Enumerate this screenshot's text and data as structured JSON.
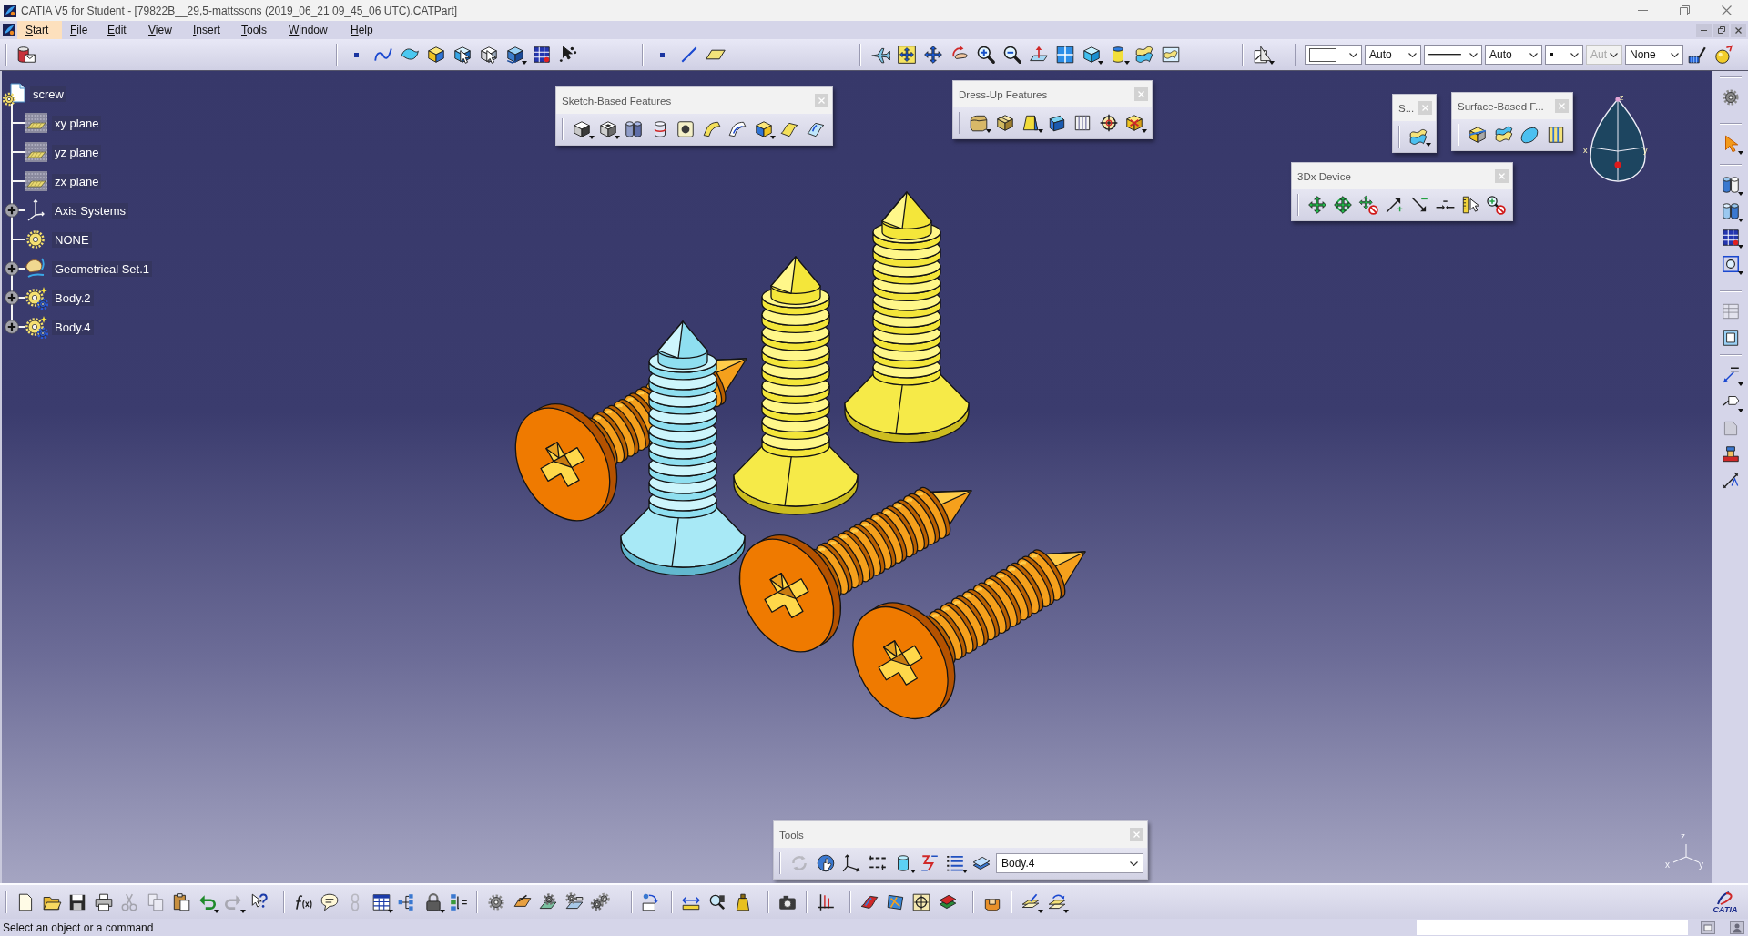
{
  "window": {
    "title": "CATIA V5 for Student - [79822B__29,5-mattssons (2019_06_21 09_45_06 UTC).CATPart]"
  },
  "menu_bar": {
    "items": [
      {
        "label": "Start",
        "selected": true
      },
      {
        "label": "File",
        "selected": false
      },
      {
        "label": "Edit",
        "selected": false
      },
      {
        "label": "View",
        "selected": false
      },
      {
        "label": "Insert",
        "selected": false
      },
      {
        "label": "Tools",
        "selected": false
      },
      {
        "label": "Window",
        "selected": false
      },
      {
        "label": "Help",
        "selected": false
      }
    ]
  },
  "top_toolbar": {
    "groups": [
      {
        "buttons": [
          {
            "kind": "part",
            "flyout": false,
            "disabled": false
          }
        ]
      },
      {
        "buttons": [
          {
            "kind": "point",
            "flyout": false,
            "disabled": false
          },
          {
            "kind": "spline",
            "flyout": false,
            "disabled": false
          },
          {
            "kind": "surface",
            "flyout": false,
            "disabled": false
          },
          {
            "kind": "boxface",
            "flyout": false,
            "disabled": false
          },
          {
            "kind": "extrude",
            "flyout": false,
            "disabled": false
          },
          {
            "kind": "revolve",
            "flyout": false,
            "disabled": false
          },
          {
            "kind": "blocks",
            "flyout": true,
            "disabled": false
          },
          {
            "kind": "grid",
            "flyout": false,
            "disabled": false
          },
          {
            "kind": "cursor",
            "flyout": false,
            "disabled": false
          }
        ]
      },
      {
        "buttons": [
          {
            "kind": "point",
            "flyout": false,
            "disabled": false
          },
          {
            "kind": "line",
            "flyout": false,
            "disabled": false
          },
          {
            "kind": "plane",
            "flyout": false,
            "disabled": false
          }
        ]
      },
      {
        "buttons": [
          {
            "kind": "fly",
            "flyout": false,
            "disabled": false
          },
          {
            "kind": "fitall",
            "flyout": false,
            "disabled": false
          },
          {
            "kind": "pan",
            "flyout": false,
            "disabled": false
          },
          {
            "kind": "rotate",
            "flyout": false,
            "disabled": false
          },
          {
            "kind": "zoomin",
            "flyout": false,
            "disabled": false
          },
          {
            "kind": "zoomout",
            "flyout": false,
            "disabled": false
          },
          {
            "kind": "normal",
            "flyout": false,
            "disabled": false
          },
          {
            "kind": "views",
            "flyout": false,
            "disabled": false
          },
          {
            "kind": "iso",
            "flyout": true,
            "disabled": false
          },
          {
            "kind": "shading",
            "flyout": true,
            "disabled": false
          },
          {
            "kind": "hide",
            "flyout": false,
            "disabled": false
          },
          {
            "kind": "swap",
            "flyout": false,
            "disabled": false
          }
        ]
      },
      {
        "buttons": [
          {
            "kind": "drafting",
            "flyout": true,
            "disabled": false
          }
        ]
      },
      {
        "combos": [
          {
            "kind": "swatch",
            "disabled": false
          },
          {
            "kind": "text",
            "value": "Auto",
            "disabled": false
          },
          {
            "kind": "line",
            "disabled": false
          },
          {
            "kind": "text",
            "value": "Auto",
            "disabled": false
          },
          {
            "kind": "point",
            "disabled": false
          },
          {
            "kind": "text",
            "value": "Aut",
            "disabled": true
          },
          {
            "kind": "text",
            "value": "None",
            "disabled": false
          }
        ],
        "buttons": [
          {
            "kind": "brush",
            "flyout": false,
            "disabled": false
          },
          {
            "kind": "paint",
            "flyout": false,
            "disabled": false
          }
        ]
      }
    ]
  },
  "tree": {
    "label": "screw",
    "kind": "part",
    "children": [
      {
        "label": "xy plane",
        "kind": "plane",
        "collapsed": false
      },
      {
        "label": "yz plane",
        "kind": "plane",
        "collapsed": false
      },
      {
        "label": "zx plane",
        "kind": "plane",
        "collapsed": false
      },
      {
        "label": "Axis Systems",
        "kind": "axes",
        "collapsed": true
      },
      {
        "label": "NONE",
        "kind": "body",
        "collapsed": false
      },
      {
        "label": "Geometrical Set.1",
        "kind": "geoset",
        "collapsed": true
      },
      {
        "label": "Body.2",
        "kind": "body_star",
        "collapsed": true
      },
      {
        "label": "Body.4",
        "kind": "body_star",
        "collapsed": true
      }
    ]
  },
  "floating_toolbars": [
    {
      "title": "Sketch-Based Features",
      "buttons": [
        {
          "kind": "pad",
          "flyout": true,
          "disabled": false
        },
        {
          "kind": "pocket",
          "flyout": true,
          "disabled": false
        },
        {
          "kind": "shaft",
          "flyout": false,
          "disabled": false
        },
        {
          "kind": "groove",
          "flyout": false,
          "disabled": false
        },
        {
          "kind": "hole",
          "flyout": false,
          "disabled": false
        },
        {
          "kind": "rib",
          "flyout": false,
          "disabled": false
        },
        {
          "kind": "slot",
          "flyout": false,
          "disabled": false
        },
        {
          "kind": "stiffener",
          "flyout": true,
          "disabled": false
        },
        {
          "kind": "loft",
          "flyout": false,
          "disabled": false
        },
        {
          "kind": "removeloft",
          "flyout": false,
          "disabled": false
        }
      ]
    },
    {
      "title": "Dress-Up Features",
      "buttons": [
        {
          "kind": "fillet",
          "flyout": true,
          "disabled": false
        },
        {
          "kind": "chamfer",
          "flyout": false,
          "disabled": false
        },
        {
          "kind": "draft",
          "flyout": true,
          "disabled": false
        },
        {
          "kind": "shell",
          "flyout": false,
          "disabled": false
        },
        {
          "kind": "thickness",
          "flyout": false,
          "disabled": false
        },
        {
          "kind": "thread",
          "flyout": false,
          "disabled": false
        },
        {
          "kind": "removeface",
          "flyout": true,
          "disabled": false
        }
      ]
    },
    {
      "title": "S...",
      "buttons": [
        {
          "kind": "sheet",
          "flyout": true,
          "disabled": false
        }
      ]
    },
    {
      "title": "Surface-Based F...",
      "buttons": [
        {
          "kind": "split",
          "flyout": false,
          "disabled": false
        },
        {
          "kind": "thicksurface",
          "flyout": false,
          "disabled": false
        },
        {
          "kind": "closesurface",
          "flyout": false,
          "disabled": false
        },
        {
          "kind": "sew",
          "flyout": false,
          "disabled": false
        }
      ]
    },
    {
      "title": "3Dx Device",
      "buttons": [
        {
          "kind": "pan3d",
          "flyout": false,
          "disabled": false
        },
        {
          "kind": "orbit3d",
          "flyout": false,
          "disabled": false
        },
        {
          "kind": "panoff",
          "flyout": false,
          "disabled": false
        },
        {
          "kind": "zoomin3d",
          "flyout": false,
          "disabled": false
        },
        {
          "kind": "zoomout3d",
          "flyout": false,
          "disabled": false
        },
        {
          "kind": "dominant",
          "flyout": false,
          "disabled": false
        },
        {
          "kind": "sensitivity",
          "flyout": false,
          "disabled": false
        },
        {
          "kind": "zoomoff",
          "flyout": false,
          "disabled": false
        }
      ]
    },
    {
      "title": "Tools",
      "buttons": [
        {
          "kind": "update",
          "flyout": false,
          "disabled": true
        },
        {
          "kind": "globe",
          "flyout": false,
          "disabled": false
        },
        {
          "kind": "axis",
          "flyout": false,
          "disabled": false
        },
        {
          "kind": "values",
          "flyout": false,
          "disabled": false
        },
        {
          "kind": "cylinder",
          "flyout": true,
          "disabled": false
        },
        {
          "kind": "zigzag",
          "flyout": false,
          "disabled": false
        },
        {
          "kind": "list",
          "flyout": true,
          "disabled": false
        },
        {
          "kind": "body",
          "flyout": false,
          "disabled": false
        }
      ],
      "combo": {
        "value": "Body.4"
      }
    }
  ],
  "compass": {
    "axis_labels": [
      "z",
      "x",
      "y"
    ]
  },
  "axis_triad": {
    "axis_labels": [
      "z",
      "x",
      "y"
    ]
  },
  "right_toolbar": {
    "groups": [
      {
        "buttons": [
          {
            "kind": "gear",
            "flyout": false,
            "disabled": false
          }
        ]
      },
      {
        "buttons": [
          {
            "kind": "select",
            "flyout": true,
            "disabled": false
          }
        ]
      },
      {
        "buttons": [
          {
            "kind": "cubes",
            "flyout": true,
            "disabled": false
          },
          {
            "kind": "cubes2",
            "flyout": true,
            "disabled": false
          },
          {
            "kind": "grid",
            "flyout": true,
            "disabled": false
          },
          {
            "kind": "fit",
            "flyout": true,
            "disabled": false
          }
        ]
      },
      {
        "buttons": [
          {
            "kind": "table2",
            "flyout": false,
            "disabled": true
          },
          {
            "kind": "frame",
            "flyout": false,
            "disabled": false
          }
        ]
      },
      {
        "buttons": [
          {
            "kind": "abc",
            "flyout": true,
            "disabled": false
          },
          {
            "kind": "arrowshape",
            "flyout": true,
            "disabled": false
          },
          {
            "kind": "grey3",
            "flyout": false,
            "disabled": true
          },
          {
            "kind": "stamp",
            "flyout": false,
            "disabled": false
          },
          {
            "kind": "dimension",
            "flyout": false,
            "disabled": false
          }
        ]
      }
    ]
  },
  "bottom_toolbar": {
    "groups": [
      {
        "buttons": [
          {
            "kind": "new",
            "flyout": false,
            "disabled": false
          },
          {
            "kind": "open",
            "flyout": false,
            "disabled": false
          },
          {
            "kind": "save",
            "flyout": false,
            "disabled": false
          },
          {
            "kind": "print",
            "flyout": false,
            "disabled": false
          },
          {
            "kind": "cut",
            "flyout": false,
            "disabled": true
          },
          {
            "kind": "copy",
            "flyout": false,
            "disabled": true
          },
          {
            "kind": "paste",
            "flyout": false,
            "disabled": false
          },
          {
            "kind": "undo",
            "flyout": true,
            "disabled": false
          },
          {
            "kind": "redo",
            "flyout": true,
            "disabled": true
          },
          {
            "kind": "whatsthis",
            "flyout": false,
            "disabled": false
          }
        ]
      },
      {
        "buttons": [
          {
            "kind": "formula",
            "flyout": false,
            "disabled": false
          },
          {
            "kind": "bubble",
            "flyout": false,
            "disabled": false
          },
          {
            "kind": "chain",
            "flyout": false,
            "disabled": true
          },
          {
            "kind": "table",
            "flyout": true,
            "disabled": false
          },
          {
            "kind": "treegraph",
            "flyout": false,
            "disabled": false
          },
          {
            "kind": "lock",
            "flyout": true,
            "disabled": false
          },
          {
            "kind": "equations",
            "flyout": false,
            "disabled": false
          }
        ]
      },
      {
        "buttons": [
          {
            "kind": "gear",
            "flyout": false,
            "disabled": false
          },
          {
            "kind": "sketcher",
            "flyout": false,
            "disabled": false
          },
          {
            "kind": "gearsheet",
            "flyout": false,
            "disabled": false
          },
          {
            "kind": "gearpipe",
            "flyout": false,
            "disabled": false
          },
          {
            "kind": "gears",
            "flyout": false,
            "disabled": false
          }
        ]
      },
      {
        "buttons": [
          {
            "kind": "boxarrow",
            "flyout": false,
            "disabled": false
          }
        ]
      },
      {
        "buttons": [
          {
            "kind": "measure",
            "flyout": false,
            "disabled": false
          },
          {
            "kind": "inertia",
            "flyout": false,
            "disabled": false
          },
          {
            "kind": "weight",
            "flyout": false,
            "disabled": false
          }
        ]
      },
      {
        "buttons": [
          {
            "kind": "camera",
            "flyout": false,
            "disabled": false
          }
        ]
      },
      {
        "buttons": [
          {
            "kind": "axes",
            "flyout": false,
            "disabled": false
          }
        ]
      },
      {
        "buttons": [
          {
            "kind": "ribbon",
            "flyout": false,
            "disabled": false
          },
          {
            "kind": "fabric",
            "flyout": false,
            "disabled": false
          },
          {
            "kind": "target",
            "flyout": false,
            "disabled": false
          },
          {
            "kind": "layers",
            "flyout": false,
            "disabled": false
          }
        ]
      },
      {
        "buttons": [
          {
            "kind": "orangebox",
            "flyout": false,
            "disabled": false
          }
        ]
      },
      {
        "buttons": [
          {
            "kind": "sheetpen",
            "flyout": true,
            "disabled": false
          },
          {
            "kind": "sheetarrow",
            "flyout": true,
            "disabled": false
          }
        ]
      }
    ],
    "logo_text": "CATIA"
  },
  "status_bar": {
    "message": "Select an object or a command"
  }
}
